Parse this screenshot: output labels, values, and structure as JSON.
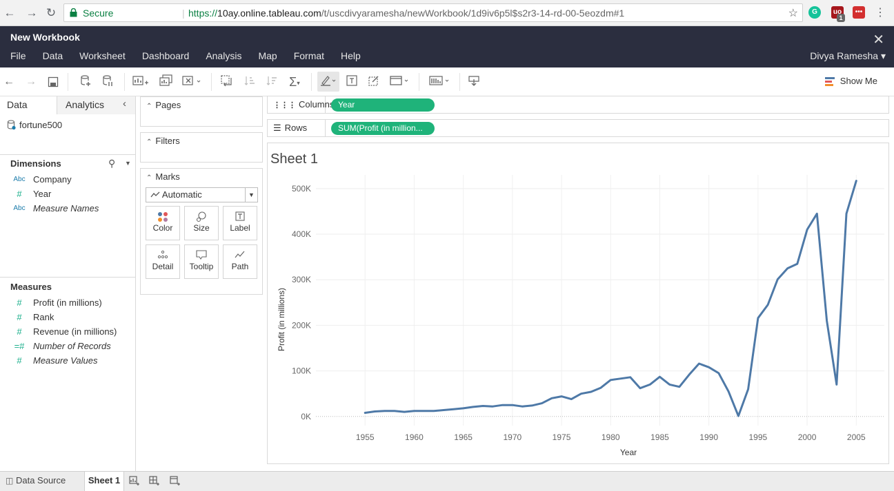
{
  "browser": {
    "secure_label": "Secure",
    "url_scheme": "https://",
    "url_host": "10ay.online.tableau.com",
    "url_path": "/t/uscdivyaramesha/newWorkbook/1d9iv6p5l$s2r3-14-rd-00-5eozdm#1",
    "ext_g": "G",
    "ext_badge": "1"
  },
  "app": {
    "title": "New Workbook",
    "close_glyph": "✕",
    "menu": [
      "File",
      "Data",
      "Worksheet",
      "Dashboard",
      "Analysis",
      "Map",
      "Format",
      "Help"
    ],
    "user": "Divya Ramesha ▾"
  },
  "toolbar": {
    "show_me": "Show Me"
  },
  "data_pane": {
    "tab_data": "Data",
    "tab_analytics": "Analytics",
    "datasource": "fortune500",
    "dimensions_title": "Dimensions",
    "dimensions": [
      {
        "type": "Abc",
        "name": "Company",
        "italic": false
      },
      {
        "type": "#",
        "name": "Year",
        "italic": false
      },
      {
        "type": "Abc",
        "name": "Measure Names",
        "italic": true
      }
    ],
    "measures_title": "Measures",
    "measures": [
      {
        "type": "#",
        "name": "Profit (in millions)",
        "italic": false
      },
      {
        "type": "#",
        "name": "Rank",
        "italic": false
      },
      {
        "type": "#",
        "name": "Revenue (in millions)",
        "italic": false
      },
      {
        "type": "=#",
        "name": "Number of Records",
        "italic": true
      },
      {
        "type": "#",
        "name": "Measure Values",
        "italic": true
      }
    ]
  },
  "cards": {
    "pages": "Pages",
    "filters": "Filters",
    "marks": "Marks",
    "mark_type": "Automatic",
    "mark_buttons": [
      "Color",
      "Size",
      "Label",
      "Detail",
      "Tooltip",
      "Path"
    ]
  },
  "shelves": {
    "columns_label": "Columns",
    "columns_pill": "Year",
    "rows_label": "Rows",
    "rows_pill": "SUM(Profit (in million..."
  },
  "sheet": {
    "title": "Sheet 1"
  },
  "chart_data": {
    "type": "line",
    "title": "",
    "xlabel": "Year",
    "ylabel": "Profit (in millions)",
    "xlim": [
      1950,
      2008
    ],
    "ylim": [
      -20000,
      530000
    ],
    "x_ticks": [
      1955,
      1960,
      1965,
      1970,
      1975,
      1980,
      1985,
      1990,
      1995,
      2000,
      2005
    ],
    "y_ticks": [
      0,
      100000,
      200000,
      300000,
      400000,
      500000
    ],
    "y_tick_labels": [
      "0K",
      "100K",
      "200K",
      "300K",
      "400K",
      "500K"
    ],
    "line_color": "#4e79a7",
    "grid": true,
    "series": [
      {
        "x": [
          1955,
          1956,
          1957,
          1958,
          1959,
          1960,
          1961,
          1962,
          1963,
          1964,
          1965,
          1966,
          1967,
          1968,
          1969,
          1970,
          1971,
          1972,
          1973,
          1974,
          1975,
          1976,
          1977,
          1978,
          1979,
          1980,
          1981,
          1982,
          1983,
          1984,
          1985,
          1986,
          1987,
          1988,
          1989,
          1990,
          1991,
          1992,
          1993,
          1994,
          1995,
          1996,
          1997,
          1998,
          1999,
          2000,
          2001,
          2002,
          2003,
          2004,
          2005
        ],
        "values": [
          8000,
          11000,
          12000,
          12000,
          10000,
          12000,
          12000,
          12000,
          14000,
          16000,
          18000,
          21000,
          23000,
          22000,
          25000,
          25000,
          22000,
          24000,
          29000,
          40000,
          44000,
          38000,
          50000,
          54000,
          63000,
          80000,
          83000,
          86000,
          62000,
          70000,
          87000,
          70000,
          65000,
          92000,
          116000,
          108000,
          95000,
          55000,
          1000,
          60000,
          216000,
          245000,
          301000,
          325000,
          335000,
          410000,
          445000,
          210000,
          70000,
          445000,
          517000
        ]
      }
    ]
  },
  "bottom": {
    "data_source": "Data Source",
    "sheet1": "Sheet 1"
  }
}
